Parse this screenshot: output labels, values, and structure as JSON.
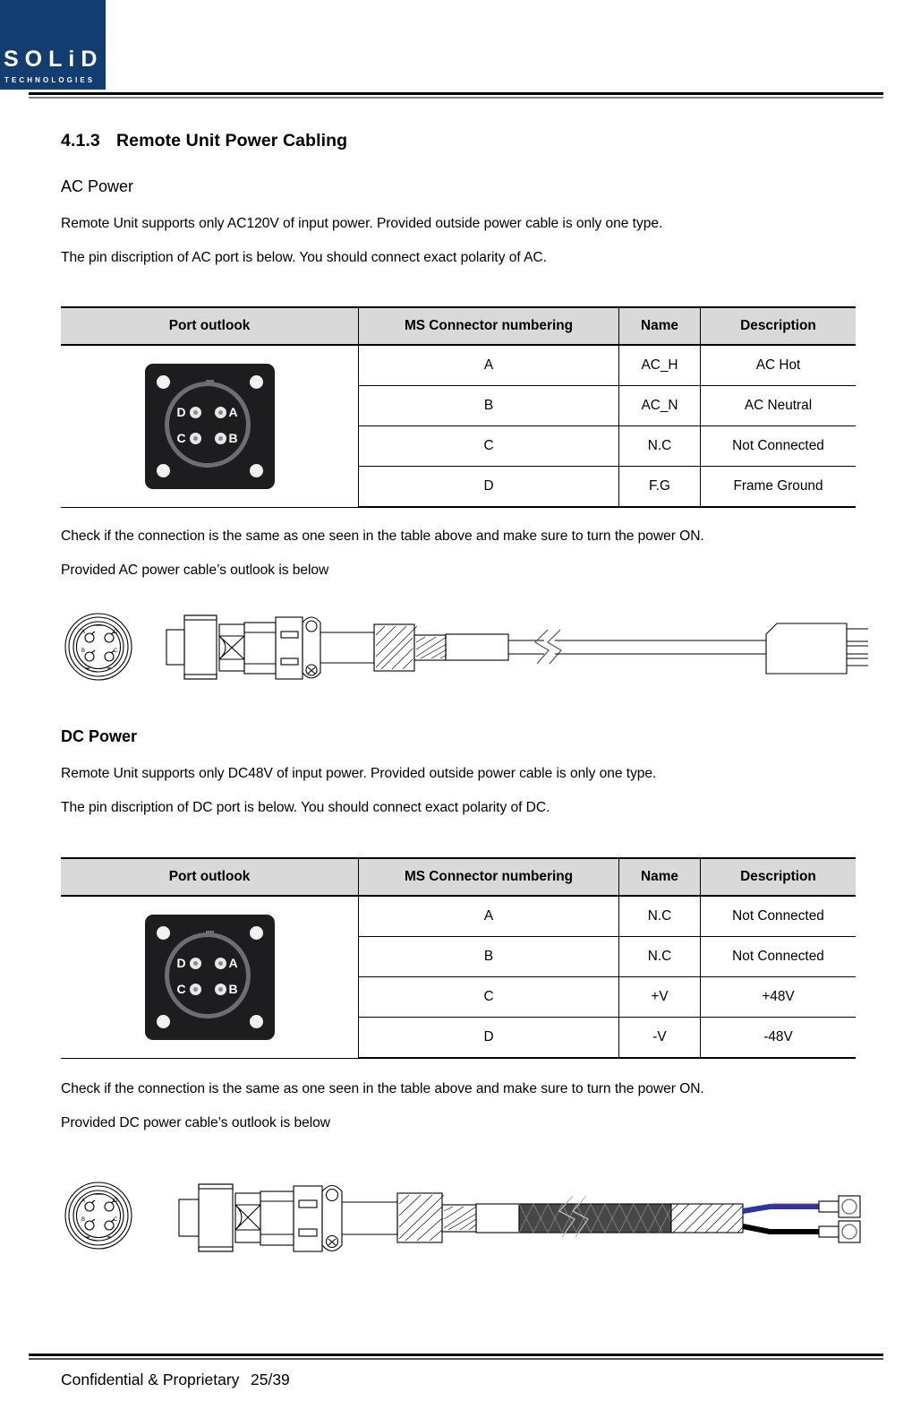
{
  "header": {
    "logo_primary": "SOLiD",
    "logo_secondary": "TECHNOLOGIES",
    "logo_bg_color": "#123d70"
  },
  "section": {
    "number": "4.1.3",
    "title": "Remote Unit Power Cabling"
  },
  "ac": {
    "heading": "AC Power",
    "intro_line1": "Remote Unit supports only AC120V of input power. Provided outside power cable is only one type.",
    "intro_line2": "The pin discription of AC port is below. You should connect exact polarity of AC.",
    "table": {
      "columns": [
        "Port outlook",
        "MS Connector numbering",
        "Name",
        "Description"
      ],
      "rows": [
        {
          "pin": "A",
          "name": "AC_H",
          "description": "AC Hot"
        },
        {
          "pin": "B",
          "name": "AC_N",
          "description": "AC Neutral"
        },
        {
          "pin": "C",
          "name": "N.C",
          "description": "Not Connected"
        },
        {
          "pin": "D",
          "name": "F.G",
          "description": "Frame Ground"
        }
      ]
    },
    "note_line1": "Check if the connection is the same as one seen in the table above and make sure to turn the power ON.",
    "note_line2": "Provided AC power cable’s outlook is below"
  },
  "dc": {
    "heading": "DC Power",
    "intro_line1": "Remote Unit supports only DC48V of input power. Provided outside power cable is only one type.",
    "intro_line2": "The pin discription of DC port is below. You should connect exact polarity of DC.",
    "table": {
      "columns": [
        "Port outlook",
        "MS Connector numbering",
        "Name",
        "Description"
      ],
      "rows": [
        {
          "pin": "A",
          "name": "N.C",
          "description": "Not Connected"
        },
        {
          "pin": "B",
          "name": "N.C",
          "description": "Not Connected"
        },
        {
          "pin": "C",
          "name": "+V",
          "description": "+48V"
        },
        {
          "pin": "D",
          "name": "-V",
          "description": "-48V"
        }
      ]
    },
    "note_line1": "Check if the connection is the same as one seen in the table above and make sure to turn the power ON.",
    "note_line2": "Provided DC power cable’s outlook is below"
  },
  "connector_photo": {
    "pin_labels": {
      "top_left": "D",
      "top_right": "A",
      "bottom_left": "C",
      "bottom_right": "B"
    }
  },
  "cable_face_labels": {
    "top_left": "A",
    "top_right": "D",
    "bottom_left": "B",
    "bottom_right": "C"
  },
  "dc_cable_wire_colors": {
    "positive": "#2a35a8",
    "negative": "#000000"
  },
  "footer": {
    "left": "Confidential & Proprietary",
    "page": "25/39"
  }
}
